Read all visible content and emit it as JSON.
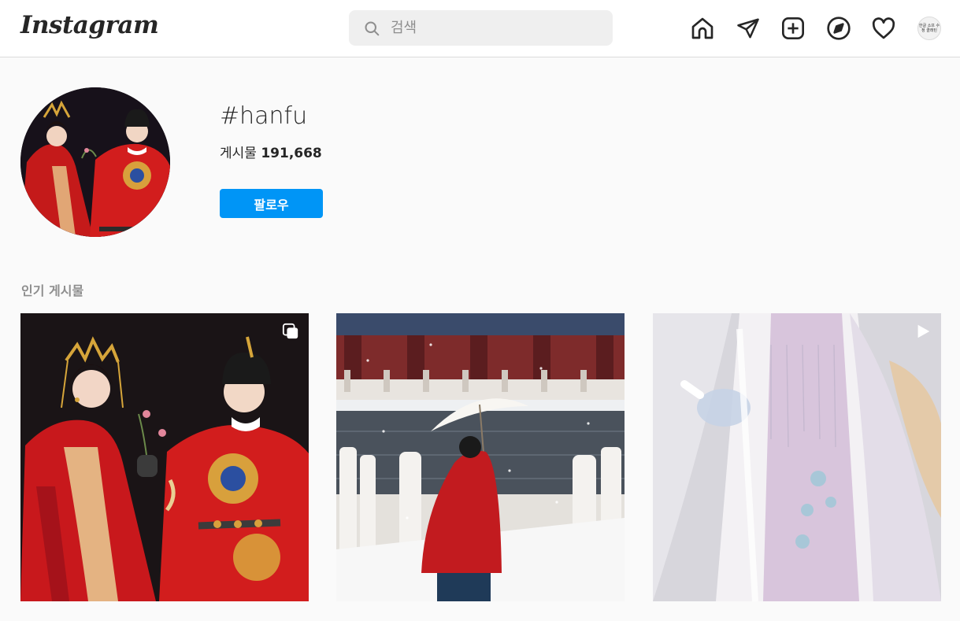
{
  "header": {
    "logo_text": "Instagram",
    "search": {
      "placeholder": "검색",
      "value": ""
    },
    "avatar_text": "한글 소프 수정 클래틴"
  },
  "nav_icons": [
    "home-icon",
    "direct-icon",
    "new-post-icon",
    "explore-icon",
    "activity-icon"
  ],
  "profile": {
    "hashtag": "#hanfu",
    "posts_label": "게시물",
    "posts_count": "191,668",
    "follow_label": "팔로우"
  },
  "top_posts": {
    "title": "인기 게시물",
    "items": [
      {
        "name": "post-1",
        "badge": "carousel-icon",
        "theme": "red"
      },
      {
        "name": "post-2",
        "badge": "",
        "theme": "snow"
      },
      {
        "name": "post-3",
        "badge": "video-icon",
        "theme": "lavender"
      }
    ]
  },
  "colors": {
    "accent": "#0095f6",
    "border": "#dbdbdb",
    "background": "#fafafa",
    "muted": "#8e8e8e"
  }
}
